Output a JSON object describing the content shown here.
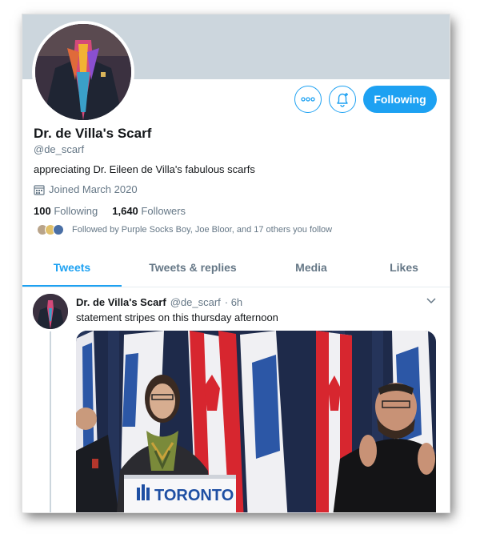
{
  "profile": {
    "name": "Dr. de Villa's Scarf",
    "handle": "@de_scarf",
    "bio": "appreciating Dr. Eileen de Villa's fabulous scarfs",
    "joined": "Joined March 2020",
    "following_count": "100",
    "following_label": "Following",
    "followers_count": "1,640",
    "followers_label": "Followers",
    "followed_by": "Followed by Purple Socks Boy, Joe Bloor, and 17 others you follow"
  },
  "actions": {
    "more_icon": "more-icon",
    "notify_icon": "bell-plus-icon",
    "follow_label": "Following"
  },
  "tabs": [
    {
      "label": "Tweets"
    },
    {
      "label": "Tweets & replies"
    },
    {
      "label": "Media"
    },
    {
      "label": "Likes"
    }
  ],
  "tweet": {
    "name": "Dr. de Villa's Scarf",
    "handle": "@de_scarf",
    "time": "· 6h",
    "text": "statement stripes on this thursday afternoon",
    "image_sign_text": "TORONTO"
  },
  "colors": {
    "accent": "#1da1f2",
    "banner": "#ccd6dd",
    "muted": "#657786"
  }
}
